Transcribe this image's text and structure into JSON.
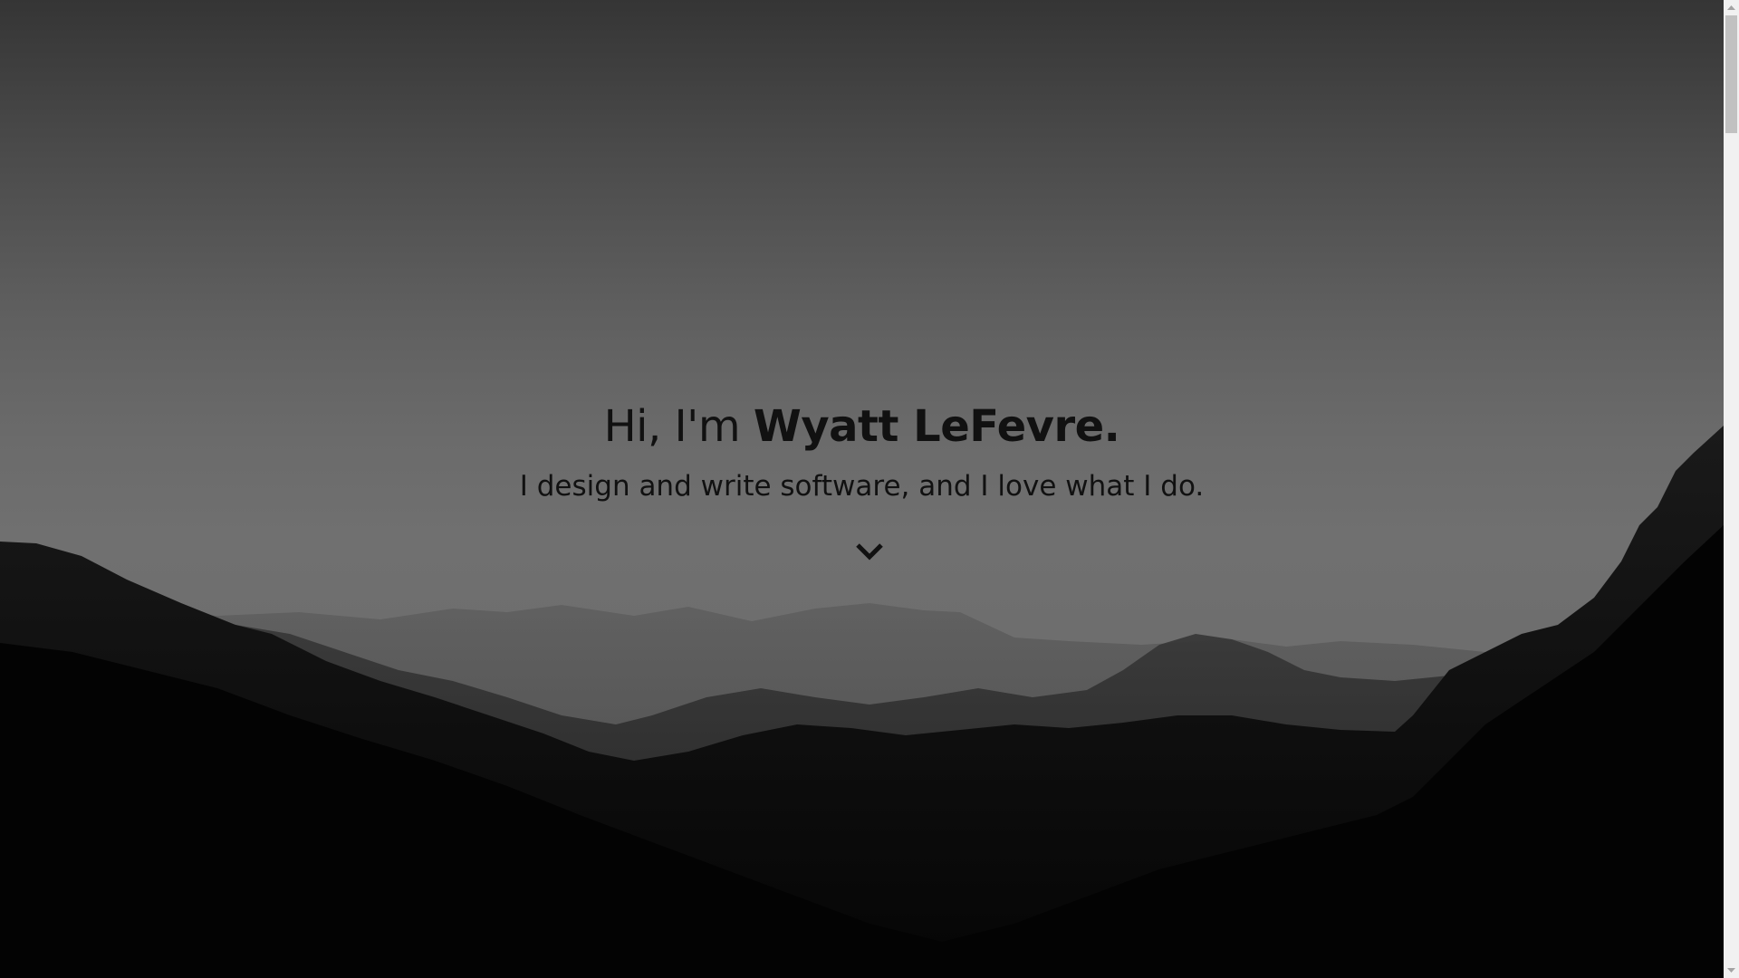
{
  "hero": {
    "greeting": "Hi, I'm ",
    "name": "Wyatt LeFevre.",
    "tagline": "I design and write software, and I love what I do."
  },
  "icons": {
    "scroll_down": "chevron-down-icon"
  },
  "colors": {
    "text": "#111111",
    "sky_top": "#353535",
    "sky_mid": "#707070",
    "mountains_dark": "#0a0a0a"
  }
}
